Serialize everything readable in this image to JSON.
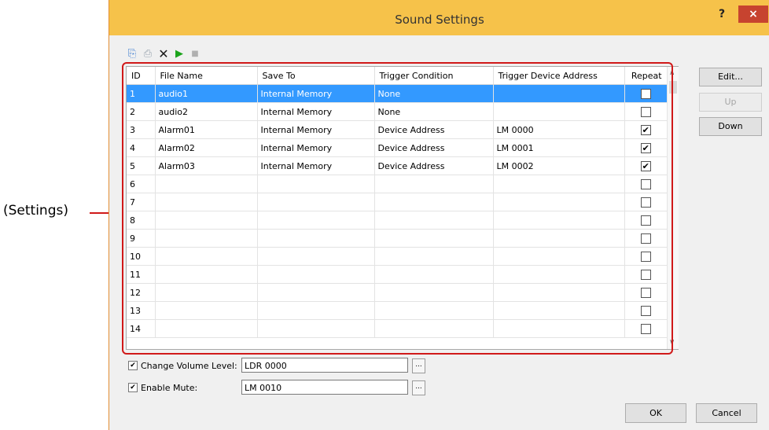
{
  "callout": {
    "label": "(Settings)"
  },
  "window": {
    "title": "Sound Settings",
    "help": "?",
    "close": "×"
  },
  "toolbar": {
    "copy_icon": "copy-icon",
    "paste_icon": "paste-icon",
    "delete_icon": "delete-icon",
    "play_icon": "play-icon",
    "stop_icon": "stop-icon"
  },
  "grid": {
    "headers": [
      "ID",
      "File Name",
      "Save To",
      "Trigger Condition",
      "Trigger Device Address",
      "Repeat"
    ],
    "rows": [
      {
        "id": "1",
        "file": "audio1",
        "save": "Internal Memory",
        "cond": "None",
        "addr": "",
        "repeat": false,
        "selected": true
      },
      {
        "id": "2",
        "file": "audio2",
        "save": "Internal Memory",
        "cond": "None",
        "addr": "",
        "repeat": false
      },
      {
        "id": "3",
        "file": "Alarm01",
        "save": "Internal Memory",
        "cond": "Device Address",
        "addr": "LM 0000",
        "repeat": true
      },
      {
        "id": "4",
        "file": "Alarm02",
        "save": "Internal Memory",
        "cond": "Device Address",
        "addr": "LM 0001",
        "repeat": true
      },
      {
        "id": "5",
        "file": "Alarm03",
        "save": "Internal Memory",
        "cond": "Device Address",
        "addr": "LM 0002",
        "repeat": true
      },
      {
        "id": "6",
        "file": "",
        "save": "",
        "cond": "",
        "addr": "",
        "repeat": false
      },
      {
        "id": "7",
        "file": "",
        "save": "",
        "cond": "",
        "addr": "",
        "repeat": false
      },
      {
        "id": "8",
        "file": "",
        "save": "",
        "cond": "",
        "addr": "",
        "repeat": false
      },
      {
        "id": "9",
        "file": "",
        "save": "",
        "cond": "",
        "addr": "",
        "repeat": false
      },
      {
        "id": "10",
        "file": "",
        "save": "",
        "cond": "",
        "addr": "",
        "repeat": false
      },
      {
        "id": "11",
        "file": "",
        "save": "",
        "cond": "",
        "addr": "",
        "repeat": false
      },
      {
        "id": "12",
        "file": "",
        "save": "",
        "cond": "",
        "addr": "",
        "repeat": false
      },
      {
        "id": "13",
        "file": "",
        "save": "",
        "cond": "",
        "addr": "",
        "repeat": false
      },
      {
        "id": "14",
        "file": "",
        "save": "",
        "cond": "",
        "addr": "",
        "repeat": false
      }
    ]
  },
  "side_buttons": {
    "edit": "Edit...",
    "up": "Up",
    "down": "Down"
  },
  "volume": {
    "label": "Change Volume Level:",
    "value": "LDR 0000",
    "checked": true,
    "browse": "..."
  },
  "mute": {
    "label": "Enable Mute:",
    "value": "LM 0010",
    "checked": true,
    "browse": "..."
  },
  "footer": {
    "ok": "OK",
    "cancel": "Cancel"
  },
  "colors": {
    "title_bar": "#f6c24a",
    "close_button": "#c7432f",
    "selection": "#3399ff",
    "annotation": "#d01919"
  }
}
